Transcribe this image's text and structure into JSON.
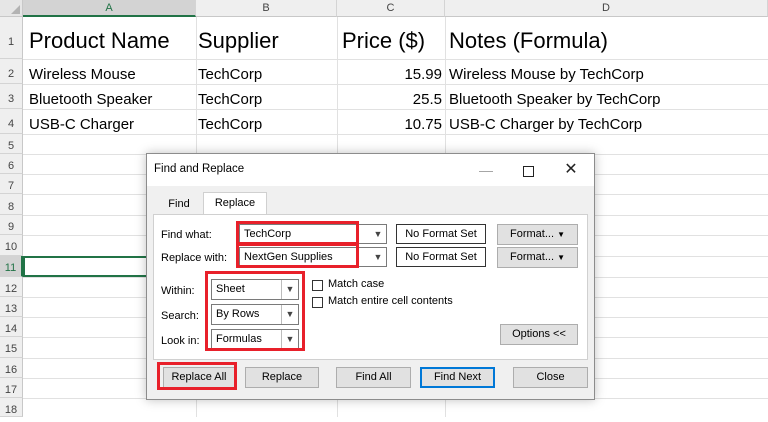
{
  "spreadsheet": {
    "columns": [
      "A",
      "B",
      "C",
      "D"
    ],
    "selected_column": "A",
    "selected_row": "11",
    "rows": [
      "1",
      "2",
      "3",
      "4",
      "5",
      "6",
      "7",
      "8",
      "9",
      "10",
      "11",
      "12",
      "13",
      "14",
      "15",
      "16",
      "17",
      "18"
    ],
    "header": {
      "a": "Product Name",
      "b": "Supplier",
      "c": "Price ($)",
      "d": "Notes (Formula)"
    },
    "data": [
      {
        "a": "Wireless Mouse",
        "b": "TechCorp",
        "c": "15.99",
        "d": "Wireless Mouse by TechCorp"
      },
      {
        "a": "Bluetooth Speaker",
        "b": "TechCorp",
        "c": "25.5",
        "d": "Bluetooth Speaker  by TechCorp"
      },
      {
        "a": "USB-C Charger",
        "b": "TechCorp",
        "c": "10.75",
        "d": "USB-C Charger  by TechCorp"
      }
    ]
  },
  "dialog": {
    "title": "Find and Replace",
    "tabs": {
      "find": "Find",
      "replace": "Replace"
    },
    "find_what": {
      "label": "Find what:",
      "value": "TechCorp",
      "format": "No Format Set"
    },
    "replace_with": {
      "label": "Replace with:",
      "value": "NextGen Supplies",
      "format": "No Format Set"
    },
    "format_button": "Format...",
    "within": {
      "label": "Within:",
      "value": "Sheet"
    },
    "search": {
      "label": "Search:",
      "value": "By Rows"
    },
    "look_in": {
      "label": "Look in:",
      "value": "Formulas"
    },
    "match_case": "Match case",
    "match_entire": "Match entire cell contents",
    "options_button": "Options <<",
    "buttons": {
      "replace_all": "Replace All",
      "replace": "Replace",
      "find_all": "Find All",
      "find_next": "Find Next",
      "close": "Close"
    }
  },
  "colors": {
    "highlight": "#e8202a",
    "excel_green": "#217346",
    "default_button_border": "#0078d7"
  },
  "icons": [
    "minimize-icon",
    "maximize-icon",
    "close-icon",
    "dropdown-arrow-icon"
  ]
}
